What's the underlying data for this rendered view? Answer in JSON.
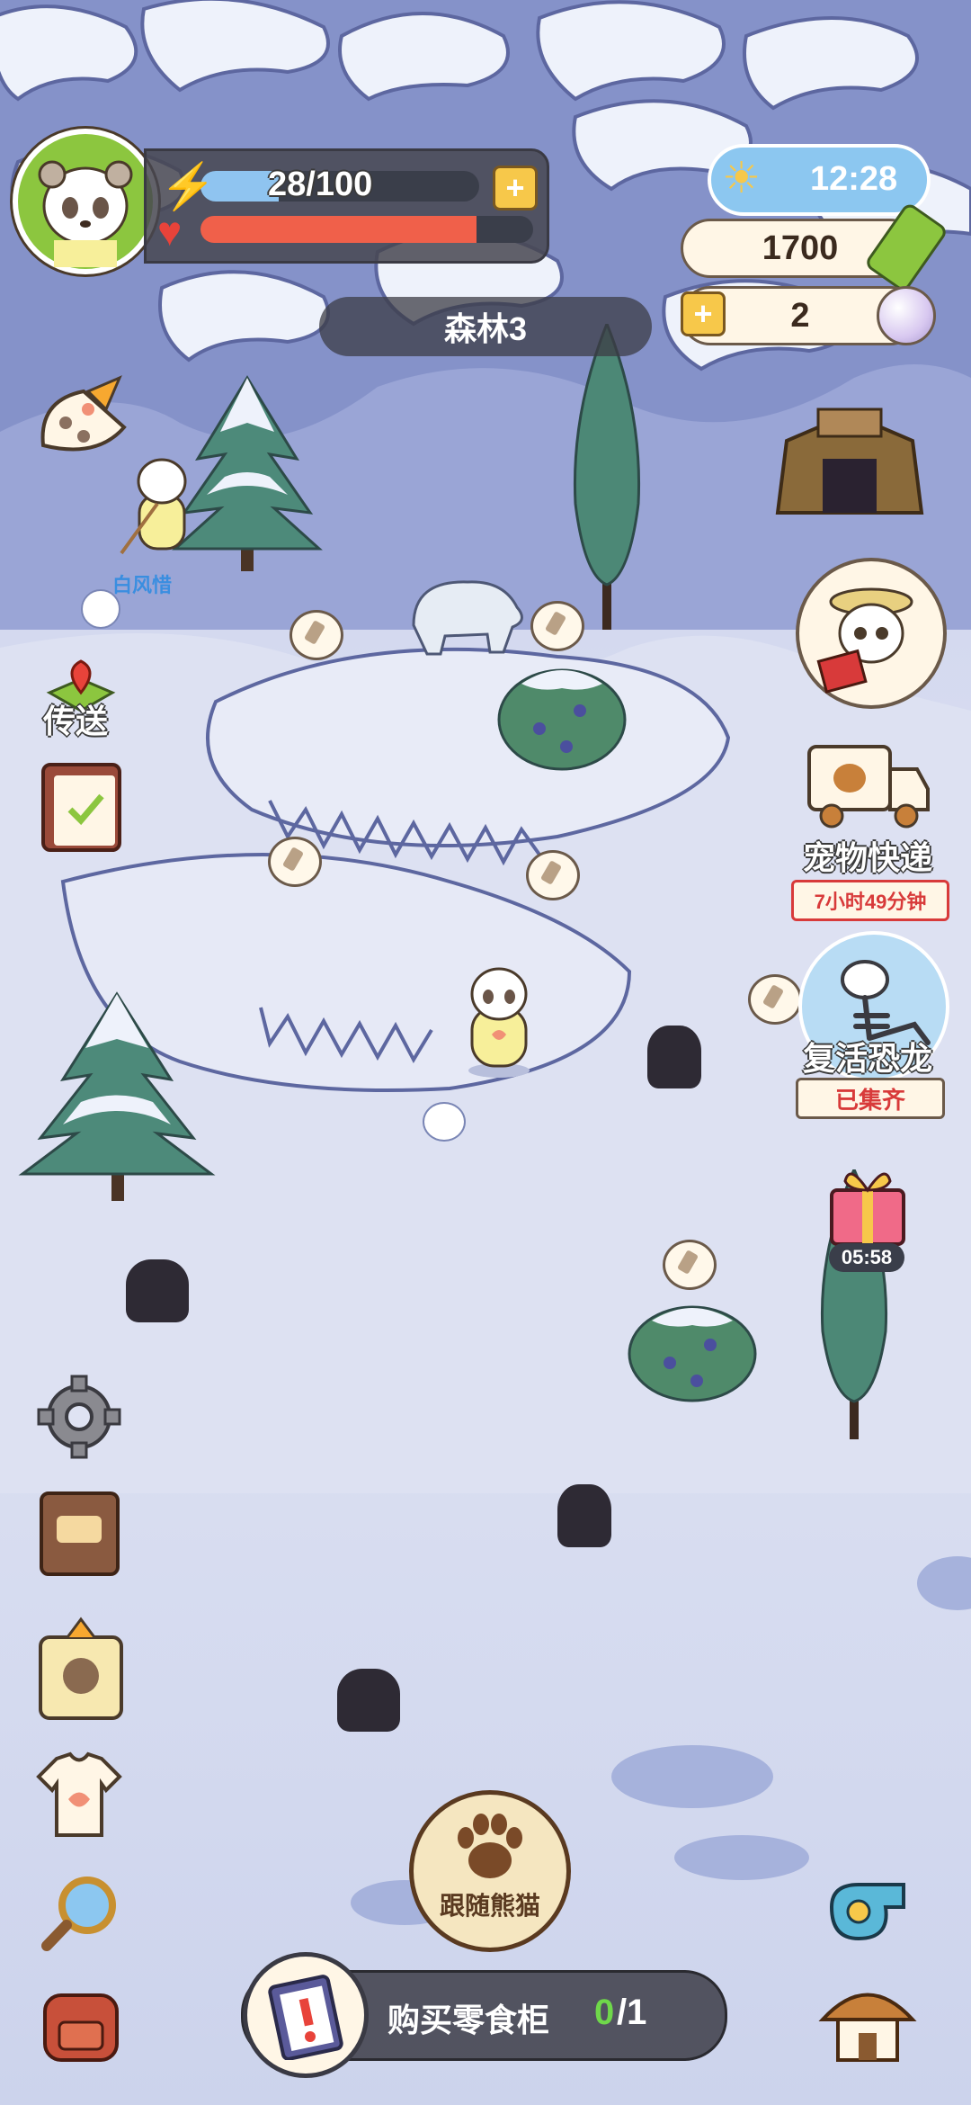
{
  "hud": {
    "energy": "28/100",
    "energy_fraction": 0.28,
    "health_fraction": 0.83,
    "plus_symbol": "+",
    "clock": "12:28",
    "coins": "1700",
    "pearls": "2",
    "location": "森林3"
  },
  "npc": {
    "name": "白风惜"
  },
  "left_menu": {
    "teleport_label": "传送"
  },
  "right_menu": {
    "pet_delivery_label": "宠物快递",
    "pet_delivery_timer": "7小时49分钟",
    "revive_dino_label": "复活恐龙",
    "revive_dino_status": "已集齐",
    "gift_timer": "05:58"
  },
  "bottom": {
    "follow_panda_label": "跟随熊猫",
    "quest_label": "购买零食柜",
    "quest_progress": "0",
    "quest_total": "/1"
  },
  "colors": {
    "energy_bar": "#8fc4f0",
    "health_bar": "#f0604a",
    "hud_panel": "#5b5b66",
    "cream": "#fff6e6",
    "accent_green": "#4caf3a"
  }
}
